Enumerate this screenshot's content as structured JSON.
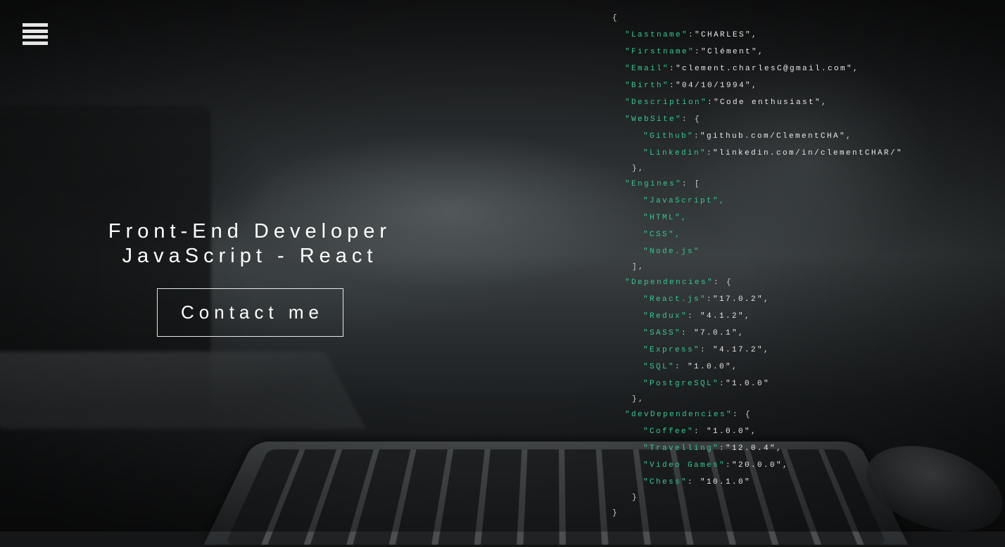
{
  "nav": {
    "menu_icon": "hamburger-menu-icon"
  },
  "hero": {
    "title_line1": "Front-End Developer",
    "title_line2": "JavaScript - React",
    "cta_label": "Contact me"
  },
  "code": {
    "open_brace": "{",
    "close_brace": "}",
    "lastname": {
      "key": "\"Lastname\"",
      "value": "\"CHARLES\","
    },
    "firstname": {
      "key": "\"Firstname\"",
      "value": "\"Clément\","
    },
    "email": {
      "key": "\"Email\"",
      "value": "\"clement.charlesC@gmail.com\","
    },
    "birth": {
      "key": "\"Birth\"",
      "value": "\"04/10/1994\","
    },
    "description": {
      "key": "\"Description\"",
      "value": "\"Code enthusiast\","
    },
    "website": {
      "key": "\"WebSite\"",
      "open": ": {",
      "close": "},",
      "github": {
        "key": "\"Github\"",
        "value": "\"github.com/ClementCHA\","
      },
      "linkedin": {
        "key": "\"Linkedin\"",
        "value": "\"linkedin.com/in/clementCHAR/\""
      }
    },
    "engines": {
      "key": "\"Engines\"",
      "open": ": [",
      "close": "],",
      "items": [
        "\"JavaScript\",",
        "\"HTML\",",
        "\"CSS\",",
        "\"Node.js\""
      ]
    },
    "dependencies": {
      "key": "\"Dependencies\"",
      "open": ": {",
      "close": "},",
      "items": [
        {
          "key": "\"React.js\"",
          "value": "\"17.0.2\","
        },
        {
          "key": "\"Redux\"",
          "value": " \"4.1.2\","
        },
        {
          "key": "\"SASS\"",
          "value": " \"7.0.1\","
        },
        {
          "key": "\"Express\"",
          "value": " \"4.17.2\","
        },
        {
          "key": "\"SQL\"",
          "value": " \"1.0.0\","
        },
        {
          "key": "\"PostgreSQL\"",
          "value": "\"1.0.0\""
        }
      ]
    },
    "dev_dependencies": {
      "key": "\"devDependencies\"",
      "open": ": {",
      "close": "}",
      "items": [
        {
          "key": "\"Coffee\"",
          "value": " \"1.0.0\","
        },
        {
          "key": "\"Travelling\"",
          "value": "\"12.0.4\","
        },
        {
          "key": "\"Video Games\"",
          "value": "\"20.0.0\","
        },
        {
          "key": "\"Chess\"",
          "value": " \"10.1.0\""
        }
      ]
    }
  }
}
